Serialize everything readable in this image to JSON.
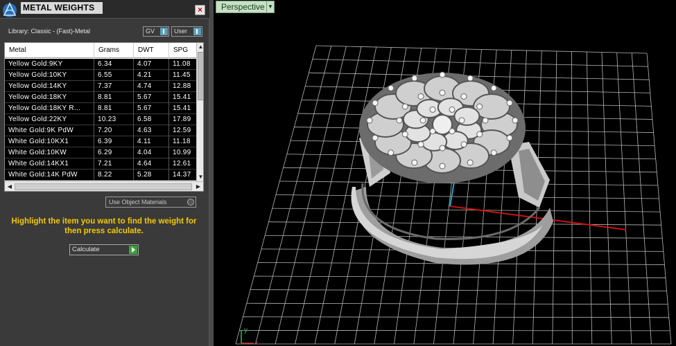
{
  "panel": {
    "title": "METAL WEIGHTS",
    "close_icon": "close-icon",
    "library_label": "Library: Classic - (Fast)-Metal",
    "gv_label": "GV",
    "user_label": "User",
    "use_object_materials": "Use Object Materials",
    "hint": "Highlight the item you want to find the weight for then press calculate.",
    "calculate_label": "Calculate"
  },
  "table": {
    "headers": [
      "Metal",
      "Grams",
      "DWT",
      "SPG"
    ],
    "rows": [
      [
        "Yellow Gold:9KY",
        "6.34",
        "4.07",
        "11.08"
      ],
      [
        "Yellow Gold:10KY",
        "6.55",
        "4.21",
        "11.45"
      ],
      [
        "Yellow Gold:14KY",
        "7.37",
        "4.74",
        "12.88"
      ],
      [
        "Yellow Gold:18KY",
        "8.81",
        "5.67",
        "15.41"
      ],
      [
        "Yellow Gold:18KY R...",
        "8.81",
        "5.67",
        "15.41"
      ],
      [
        "Yellow Gold:22KY",
        "10.23",
        "6.58",
        "17.89"
      ],
      [
        "White Gold:9K PdW",
        "7.20",
        "4.63",
        "12.59"
      ],
      [
        "White Gold:10KX1",
        "6.39",
        "4.11",
        "11.18"
      ],
      [
        "White Gold:10KW",
        "6.29",
        "4.04",
        "10.99"
      ],
      [
        "White Gold:14KX1",
        "7.21",
        "4.64",
        "12.61"
      ],
      [
        "White Gold:14K PdW",
        "8.22",
        "5.28",
        "14.37"
      ]
    ]
  },
  "viewport": {
    "label": "Perspective",
    "axis_y": "y",
    "axis_x": "x"
  },
  "colors": {
    "hint": "#f5c800",
    "grid": "#b8b8b8",
    "x_axis": "#d01010",
    "y_axis": "#28a8c8",
    "view_label_bg": "#c6e0c6"
  }
}
